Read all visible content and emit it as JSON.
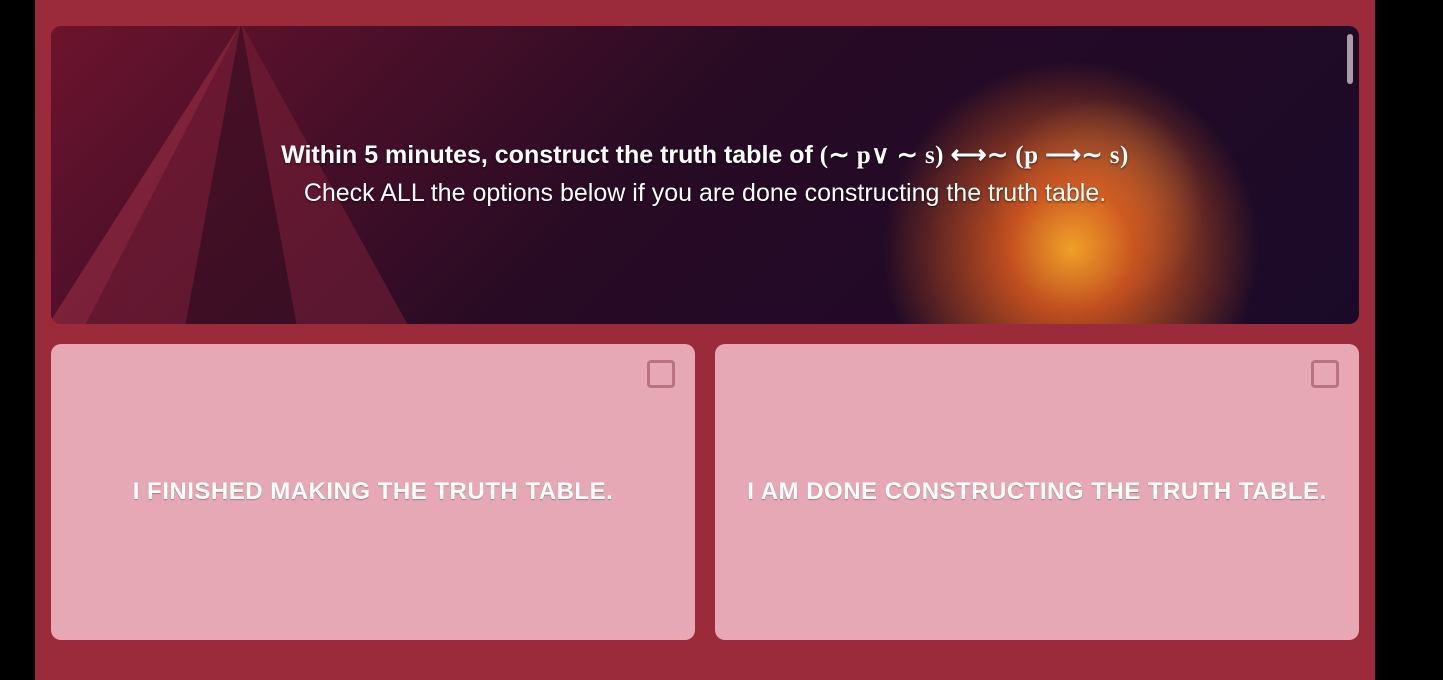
{
  "question": {
    "line1_prefix": "Within 5 minutes, construct the truth table of ",
    "formula": "(∼ p∨ ∼ s) ⟷∼ (p ⟶∼ s)",
    "line2": "Check ALL the options below if you are done constructing the truth table."
  },
  "options": [
    {
      "label": "I FINISHED MAKING THE TRUTH TABLE.",
      "checked": false
    },
    {
      "label": "I AM DONE CONSTRUCTING THE TRUTH TABLE.",
      "checked": false
    }
  ]
}
